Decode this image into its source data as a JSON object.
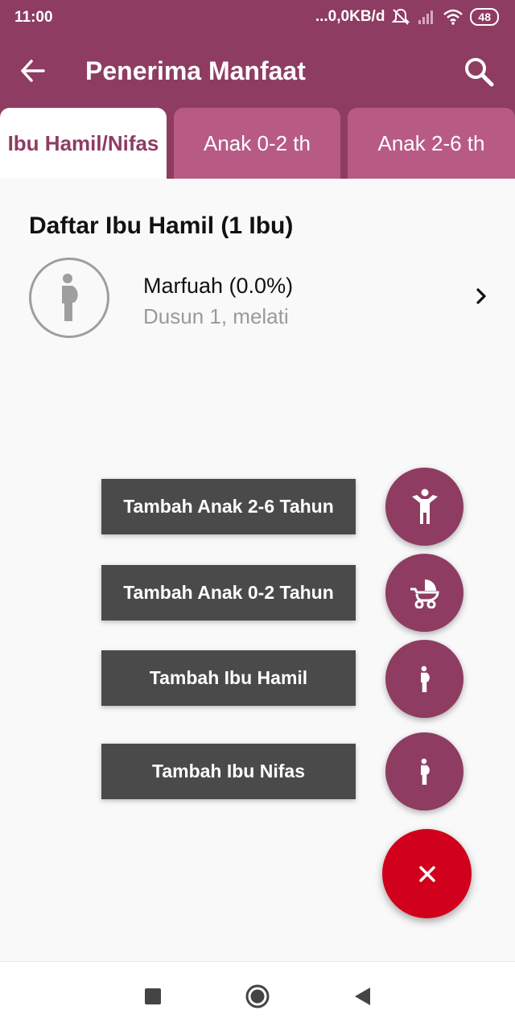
{
  "status_bar": {
    "time": "11:00",
    "network_speed": "...0,0KB/d",
    "battery": "48",
    "icons": [
      "mute-icon",
      "signal-icon",
      "wifi-icon",
      "battery-icon"
    ]
  },
  "app_bar": {
    "title": "Penerima Manfaat",
    "back_icon": "arrow-left-icon",
    "search_icon": "search-icon"
  },
  "tabs": [
    {
      "label": "Ibu Hamil/Nifas",
      "active": true
    },
    {
      "label": "Anak 0-2 th",
      "active": false
    },
    {
      "label": "Anak 2-6 th",
      "active": false
    }
  ],
  "list": {
    "title": "Daftar Ibu Hamil (1 Ibu)",
    "items": [
      {
        "name": "Marfuah (0.0%)",
        "address": "Dusun 1, melati",
        "icon": "pregnant-woman-icon"
      }
    ]
  },
  "speed_dial": [
    {
      "label": "Tambah Anak 2-6 Tahun",
      "icon": "child-icon"
    },
    {
      "label": "Tambah Anak 0-2 Tahun",
      "icon": "stroller-icon"
    },
    {
      "label": "Tambah Ibu Hamil",
      "icon": "pregnant-woman-icon"
    },
    {
      "label": "Tambah Ibu Nifas",
      "icon": "pregnant-woman-icon"
    }
  ],
  "fab_main_icon": "close-icon",
  "nav_bar": [
    "recents-icon",
    "home-icon",
    "back-icon"
  ],
  "colors": {
    "primary": "#8e3c62",
    "tab_inactive": "#b85b84",
    "fab_close": "#d1001c",
    "label_bg": "#4a4a4a"
  }
}
